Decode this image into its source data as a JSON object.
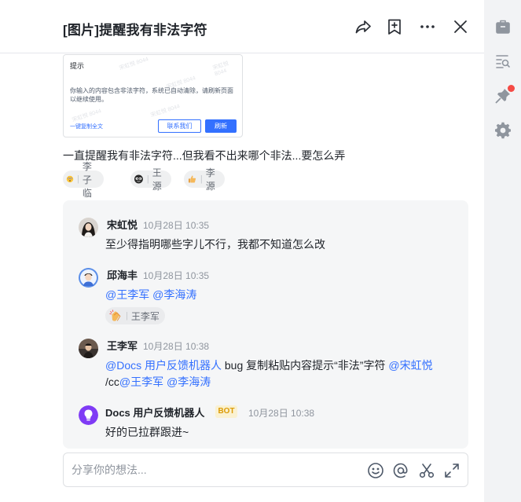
{
  "header": {
    "title": "[图片]提醒我有非法字符",
    "icons": [
      "share-icon",
      "bookmark-icon",
      "more-icon",
      "close-icon"
    ]
  },
  "rail": {
    "icons": [
      "briefcase-icon",
      "doc-search-icon",
      "pin-icon",
      "gear-icon"
    ],
    "notification_color": "#f54a45"
  },
  "screenshot": {
    "title": "提示",
    "body": "你输入的内容包含非法字符，系统已自动清除，请刷新页面以继续使用。",
    "link": "一键复制全文",
    "contact_button": "联系我们",
    "refresh_button": "刷新"
  },
  "post": {
    "text": "一直提醒我有非法字符...但我看不出来哪个非法...要怎么弄"
  },
  "reactions": [
    {
      "emoji": "dizzy-face-emoji",
      "user": "李子临"
    },
    {
      "emoji": "sunglasses-face-emoji",
      "user": "王源"
    },
    {
      "emoji": "thumbs-up-emoji",
      "user": "李源"
    }
  ],
  "replies": [
    {
      "author": "宋虹悦",
      "time": "10月28日 10:35",
      "text": "至少得指明哪些字儿不行，我都不知道怎么改"
    },
    {
      "author": "邱海丰",
      "time": "10月28日 10:35",
      "mentions": [
        "@王李军",
        "@李海涛"
      ],
      "reaction": {
        "emoji": "clap-emoji",
        "user": "王李军"
      }
    },
    {
      "author": "王李军",
      "time": "10月28日 10:38",
      "mention1": "@Docs 用户反馈机器人",
      "text1": " bug 复制粘贴内容提示“非法”字符 ",
      "mention2": "@宋虹悦",
      "prefix2": "/cc",
      "mention3": "@王李军",
      "mention4": "@李海涛"
    },
    {
      "author": "Docs 用户反馈机器人",
      "badge": "BOT",
      "time": "10月28日 10:38",
      "text": "好的已拉群跟进~"
    }
  ],
  "composer": {
    "placeholder": "分享你的想法...",
    "icons": [
      "emoji-icon",
      "at-icon",
      "scissors-icon",
      "expand-icon"
    ]
  },
  "colors": {
    "accent": "#3370ff",
    "thread_bg": "#f5f6f7",
    "bot_badge_bg": "#faf1d1",
    "bot_badge_text": "#dc9b04"
  }
}
